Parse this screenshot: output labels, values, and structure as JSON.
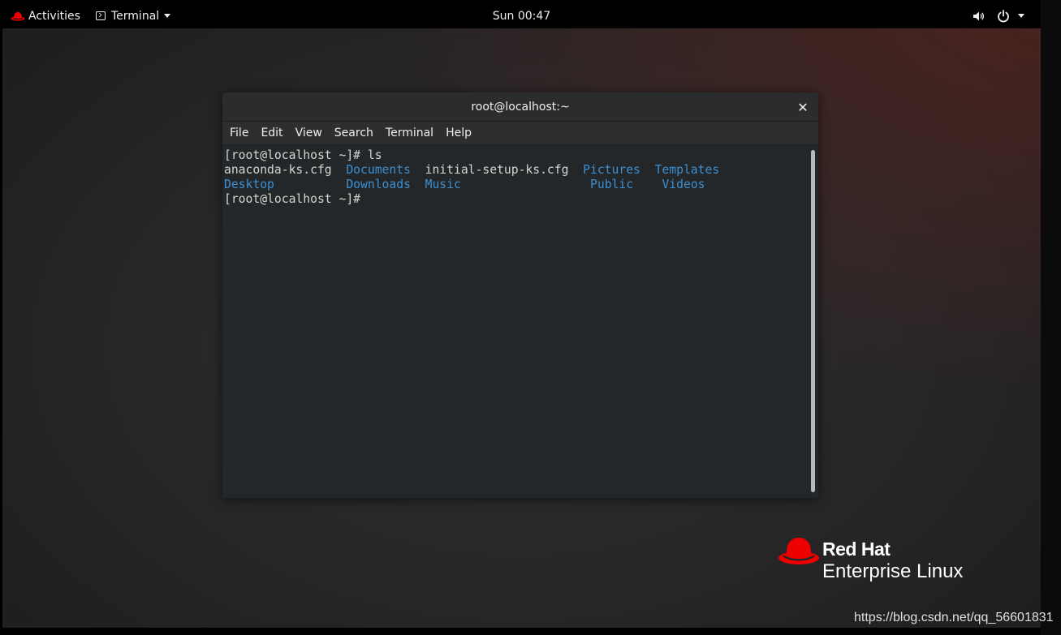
{
  "topbar": {
    "activities_label": "Activities",
    "app_menu_label": "Terminal",
    "clock": "Sun 00:47",
    "icons": [
      "redhat-icon",
      "terminal-icon",
      "volume-icon",
      "power-icon",
      "chevron-down-icon"
    ]
  },
  "terminal": {
    "title": "root@localhost:~",
    "close_glyph": "✕",
    "menu": [
      "File",
      "Edit",
      "View",
      "Search",
      "Terminal",
      "Help"
    ],
    "lines": {
      "prompt1": "[root@localhost ~]# ls",
      "row1": {
        "f1": "anaconda-ks.cfg",
        "d1": "Documents",
        "f2": "initial-setup-ks.cfg",
        "d2": "Pictures",
        "d3": "Templates"
      },
      "row2": {
        "d1": "Desktop",
        "d2": "Downloads",
        "d3": "Music",
        "d4": "Public",
        "d5": "Videos"
      },
      "prompt2": "[root@localhost ~]#"
    },
    "colors": {
      "directory": "#3d8fd1",
      "text": "#d3d7cf",
      "background": "#24272a"
    }
  },
  "branding": {
    "line1": "Red Hat",
    "line2": "Enterprise Linux",
    "accent": "#ee0000"
  },
  "watermark": "https://blog.csdn.net/qq_56601831"
}
